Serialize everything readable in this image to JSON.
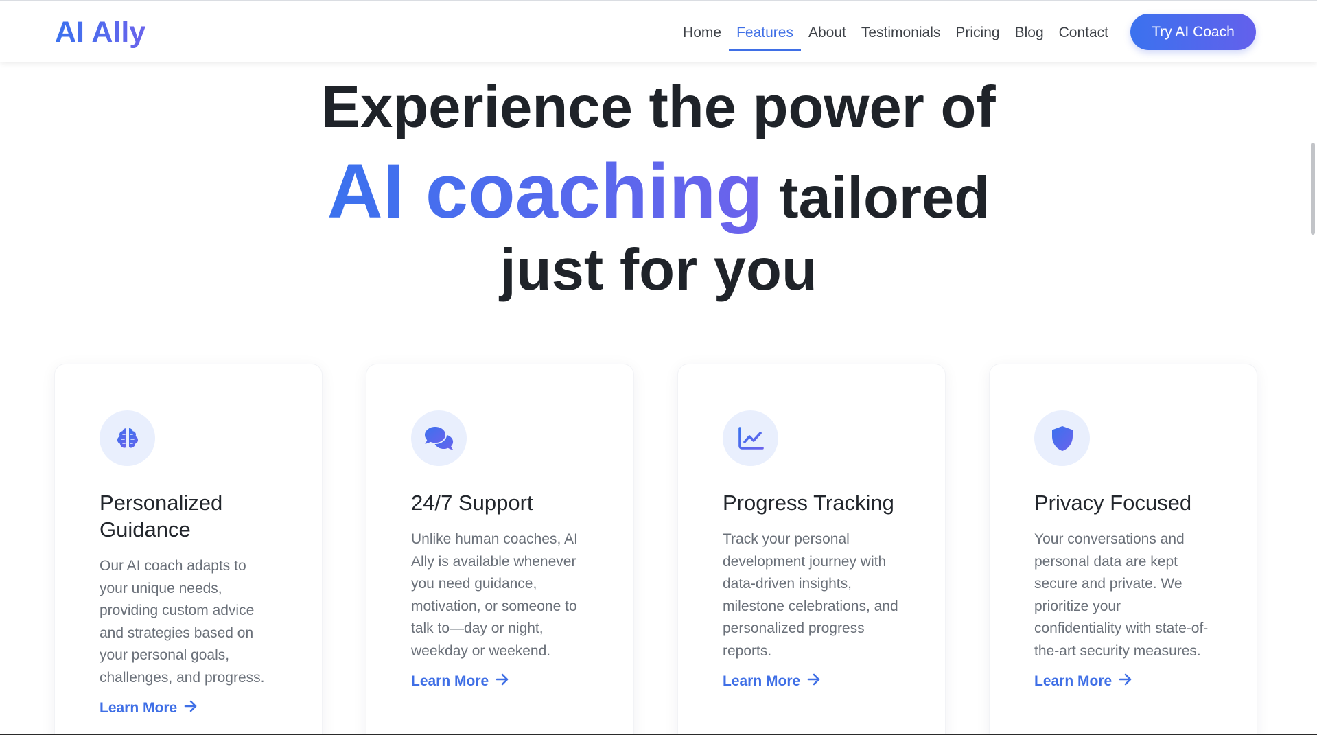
{
  "brand": "AI Ally",
  "nav": {
    "links": [
      "Home",
      "Features",
      "About",
      "Testimonials",
      "Pricing",
      "Blog",
      "Contact"
    ],
    "active": "Features",
    "cta": "Try AI Coach"
  },
  "hero": {
    "line1": "Experience the power of",
    "line2_accent": "AI coaching",
    "line2_rest": "tailored",
    "line3": "just for you"
  },
  "features": [
    {
      "icon": "brain-icon",
      "title": "Personalized Guidance",
      "text": "Our AI coach adapts to your unique needs, providing custom advice and strategies based on your personal goals, challenges, and progress.",
      "link": "Learn More"
    },
    {
      "icon": "chat-bubbles-icon",
      "title": "24/7 Support",
      "text": "Unlike human coaches, AI Ally is available whenever you need guidance, motivation, or someone to talk to—day or night, weekday or weekend.",
      "link": "Learn More"
    },
    {
      "icon": "line-chart-icon",
      "title": "Progress Tracking",
      "text": "Track your personal development journey with data-driven insights, milestone celebrations, and personalized progress reports.",
      "link": "Learn More"
    },
    {
      "icon": "shield-icon",
      "title": "Privacy Focused",
      "text": "Your conversations and personal data are kept secure and private. We prioritize your confidentiality with state-of-the-art security measures.",
      "link": "Learn More"
    }
  ],
  "colors": {
    "accent": "#3f6fe6",
    "accent_end": "#6c62ec",
    "icon_bg": "#e9effd",
    "heading": "#1f2329",
    "body_text": "#6a7079"
  }
}
